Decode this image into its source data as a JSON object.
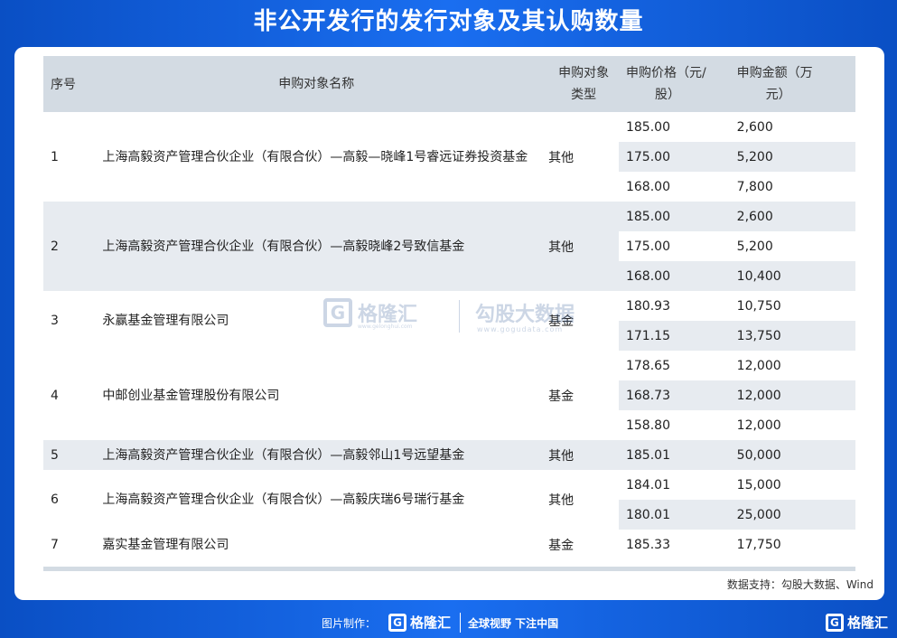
{
  "title": "非公开发行的发行对象及其认购数量",
  "table": {
    "headers": {
      "idx": "序号",
      "name": "申购对象名称",
      "type_l1": "申购对象",
      "type_l2": "类型",
      "price_l1": "申购价格（元/",
      "price_l2": "股）",
      "amount_l1": "申购金额（万",
      "amount_l2": "元）"
    },
    "rows": [
      {
        "idx": "1",
        "name": "上海高毅资产管理合伙企业（有限合伙）—高毅—晓峰1号睿远证券投资基金",
        "type": "其他",
        "bids": [
          {
            "price": "185.00",
            "amount": "2,600"
          },
          {
            "price": "175.00",
            "amount": "5,200"
          },
          {
            "price": "168.00",
            "amount": "7,800"
          }
        ]
      },
      {
        "idx": "2",
        "name": "上海高毅资产管理合伙企业（有限合伙）—高毅晓峰2号致信基金",
        "type": "其他",
        "bids": [
          {
            "price": "185.00",
            "amount": "2,600"
          },
          {
            "price": "175.00",
            "amount": "5,200"
          },
          {
            "price": "168.00",
            "amount": "10,400"
          }
        ]
      },
      {
        "idx": "3",
        "name": "永赢基金管理有限公司",
        "type": "基金",
        "bids": [
          {
            "price": "180.93",
            "amount": "10,750"
          },
          {
            "price": "171.15",
            "amount": "13,750"
          }
        ]
      },
      {
        "idx": "4",
        "name": "中邮创业基金管理股份有限公司",
        "type": "基金",
        "bids": [
          {
            "price": "178.65",
            "amount": "12,000"
          },
          {
            "price": "168.73",
            "amount": "12,000"
          },
          {
            "price": "158.80",
            "amount": "12,000"
          }
        ]
      },
      {
        "idx": "5",
        "name": "上海高毅资产管理合伙企业（有限合伙）—高毅邻山1号远望基金",
        "type": "其他",
        "bids": [
          {
            "price": "185.01",
            "amount": "50,000"
          }
        ]
      },
      {
        "idx": "6",
        "name": "上海高毅资产管理合伙企业（有限合伙）—高毅庆瑞6号瑞行基金",
        "type": "其他",
        "bids": [
          {
            "price": "184.01",
            "amount": "15,000"
          },
          {
            "price": "180.01",
            "amount": "25,000"
          }
        ]
      },
      {
        "idx": "7",
        "name": "嘉实基金管理有限公司",
        "type": "基金",
        "bids": [
          {
            "price": "185.33",
            "amount": "17,750"
          }
        ]
      }
    ]
  },
  "source": "数据支持：勾股大数据、Wind",
  "watermark": {
    "brand": "格隆汇",
    "brand_url": "www.gelonghui.com",
    "partner": "勾股大数据",
    "partner_url": "www.gogudata.com",
    "logo_letter": "G"
  },
  "footer": {
    "made_by": "图片制作：",
    "brand": "格隆汇",
    "slogan": "全球视野 下注中国",
    "logo_letter": "G"
  },
  "colors": {
    "background": "#1a6ef0",
    "header": "#d3dbe3",
    "stripe": "#e7ebf0"
  }
}
